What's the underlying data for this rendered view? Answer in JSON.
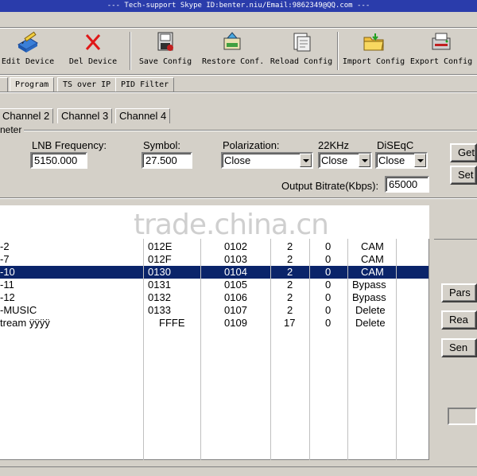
{
  "window": {
    "title": "--- Tech-support Skype ID:benter.niu/Email:9862349@QQ.com ---"
  },
  "toolbar": {
    "items": [
      {
        "label": "Edit Device",
        "icon": "edit-device-icon"
      },
      {
        "label": "Del Device",
        "icon": "delete-x-icon"
      },
      {
        "label": "Save Config",
        "icon": "save-config-icon"
      },
      {
        "label": "Restore Conf.",
        "icon": "restore-config-icon"
      },
      {
        "label": "Reload Config",
        "icon": "reload-config-icon"
      },
      {
        "label": "Import Config",
        "icon": "import-config-icon"
      },
      {
        "label": "Export Config",
        "icon": "export-config-icon"
      }
    ]
  },
  "tabs": {
    "main": [
      "Program",
      "TS over IP",
      "PID Filter"
    ],
    "channels": [
      "Channel 2",
      "Channel 3",
      "Channel 4"
    ]
  },
  "parameters": {
    "group_label": "neter",
    "lnb_label": "LNB Frequency:",
    "lnb_value": "5150.000",
    "symbol_label": "Symbol:",
    "symbol_value": "27.500",
    "polarization_label": "Polarization:",
    "polarization_value": "Close",
    "khz_label": "22KHz",
    "khz_value": "Close",
    "diseqc_label": "DiSEqC",
    "diseqc_value": "Close",
    "bitrate_label": "Output Bitrate(Kbps):",
    "bitrate_value": "65000",
    "get_button": "Get",
    "set_button": "Set"
  },
  "watermark": "trade.china.cn",
  "programs": [
    {
      "name": "-2",
      "pid": "012E",
      "pmt": "0102",
      "type": "2",
      "x": "0",
      "action": "CAM",
      "selected": false
    },
    {
      "name": "-7",
      "pid": "012F",
      "pmt": "0103",
      "type": "2",
      "x": "0",
      "action": "CAM",
      "selected": false
    },
    {
      "name": "-10",
      "pid": "0130",
      "pmt": "0104",
      "type": "2",
      "x": "0",
      "action": "CAM",
      "selected": true
    },
    {
      "name": "-11",
      "pid": "0131",
      "pmt": "0105",
      "type": "2",
      "x": "0",
      "action": "Bypass",
      "selected": false
    },
    {
      "name": "-12",
      "pid": "0132",
      "pmt": "0106",
      "type": "2",
      "x": "0",
      "action": "Bypass",
      "selected": false
    },
    {
      "name": "-MUSIC",
      "pid": "0133",
      "pmt": "0107",
      "type": "2",
      "x": "0",
      "action": "Delete",
      "selected": false
    },
    {
      "name": "tream ÿÿÿÿ",
      "pid": "FFFE",
      "pmt": "0109",
      "type": "17",
      "x": "0",
      "action": "Delete",
      "selected": false
    }
  ],
  "side_buttons": {
    "parse": "Pars",
    "read": "Rea",
    "send": "Sen"
  }
}
